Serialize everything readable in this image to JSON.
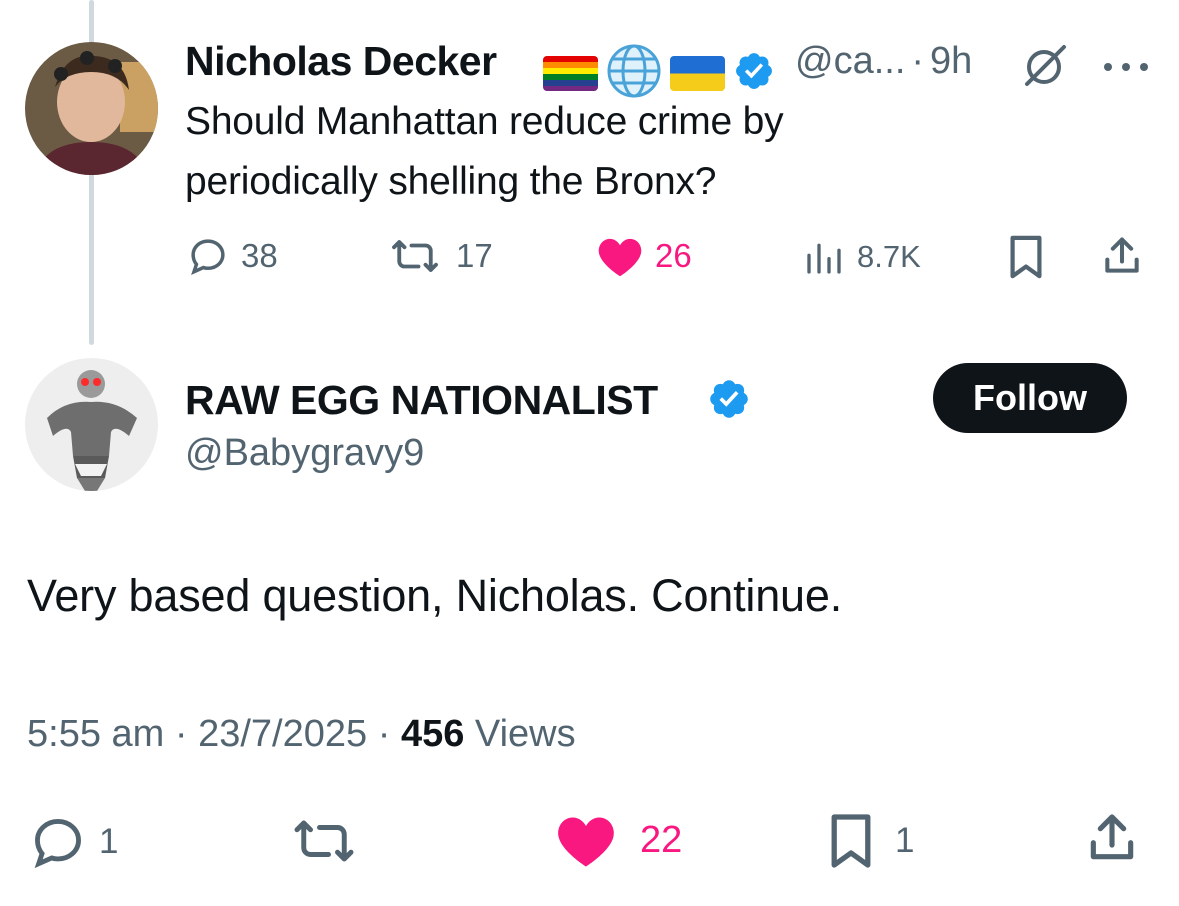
{
  "parent_tweet": {
    "author_name": "Nicholas Decker",
    "handle": "@ca...",
    "separator": "·",
    "time": "9h",
    "badges": [
      "rainbow-flag-icon",
      "globe-icon",
      "ukraine-flag-icon",
      "verified-badge-icon"
    ],
    "text_line1": "Should Manhattan reduce crime by",
    "text_line2": "periodically shelling the Bronx?",
    "replies": "38",
    "reposts": "17",
    "likes": "26",
    "views": "8.7K"
  },
  "reply_tweet": {
    "author_name": "RAW EGG NATIONALIST",
    "handle": "@Babygravy9",
    "follow_label": "Follow",
    "text": "Very based question, Nicholas. Continue.",
    "time": "5:55 am",
    "date": "23/7/2025",
    "separator": "·",
    "views_count": "456",
    "views_label": "Views",
    "replies": "1",
    "likes": "22",
    "bookmarks": "1"
  },
  "colors": {
    "like_pink": "#f91880",
    "verified_blue": "#1d9bf0",
    "muted_gray": "#536471",
    "thread_line": "#cfd9de",
    "follow_bg": "#0f1419"
  }
}
